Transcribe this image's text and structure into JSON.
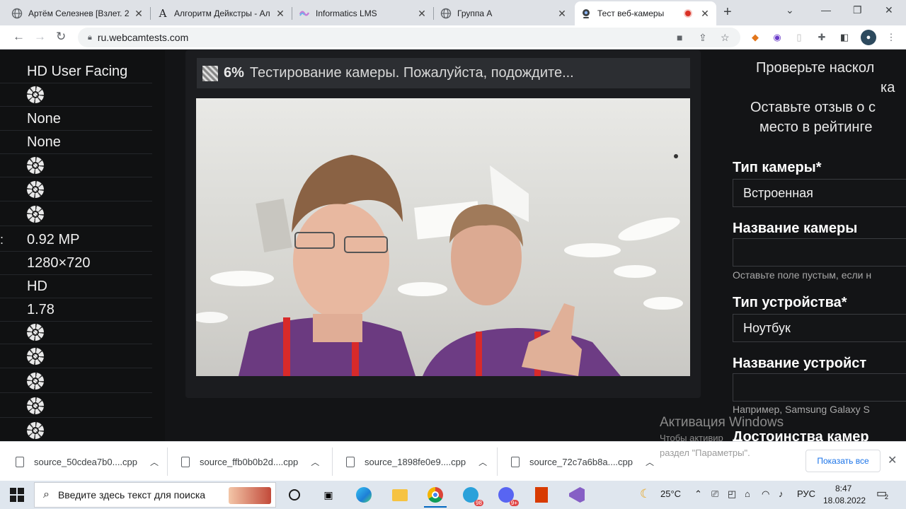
{
  "browser": {
    "tabs": [
      {
        "title": "Артём Селезнев [Взлет. 2",
        "icon": "globe-icon"
      },
      {
        "title": "Алгоритм Дейкстры - Ал",
        "icon": "wiki-a-icon"
      },
      {
        "title": "Informatics LMS",
        "icon": "lms-icon"
      },
      {
        "title": "Группа А",
        "icon": "globe-icon"
      },
      {
        "title": "Тест веб-камеры",
        "icon": "webcam-icon"
      }
    ],
    "active_tab": 4,
    "url": "ru.webcamtests.com"
  },
  "left_panel": {
    "rows": [
      {
        "key": "",
        "value": "HD User Facing",
        "icon": ""
      },
      {
        "key": "",
        "value": "",
        "icon": "loading-icon"
      },
      {
        "key": "",
        "value": "None",
        "icon": ""
      },
      {
        "key": "",
        "value": "None",
        "icon": ""
      },
      {
        "key": "",
        "value": "",
        "icon": "loading-icon"
      },
      {
        "key": "",
        "value": "",
        "icon": "loading-icon"
      },
      {
        "key": "",
        "value": "",
        "icon": "loading-icon"
      },
      {
        "key": ":",
        "value": "0.92 MP",
        "icon": ""
      },
      {
        "key": "",
        "value": "1280×720",
        "icon": ""
      },
      {
        "key": "",
        "value": "HD",
        "icon": ""
      },
      {
        "key": "",
        "value": "1.78",
        "icon": ""
      },
      {
        "key": "",
        "value": "",
        "icon": "loading-icon"
      },
      {
        "key": "",
        "value": "",
        "icon": "loading-icon"
      },
      {
        "key": "",
        "value": "",
        "icon": "loading-icon"
      },
      {
        "key": "",
        "value": "",
        "icon": "loading-icon"
      },
      {
        "key": "",
        "value": "",
        "icon": "loading-icon"
      }
    ]
  },
  "test": {
    "percent": "6%",
    "message": "Тестирование камеры. Пожалуйста, подождите..."
  },
  "form": {
    "intro_line1": "Проверьте наскол",
    "intro_line2": "ка",
    "intro_line3": "Оставьте отзыв о с",
    "intro_line4": "место в рейтинге",
    "camera_type_label": "Тип камеры*",
    "camera_type_value": "Встроенная",
    "camera_name_label": "Название камеры",
    "camera_name_hint": "Оставьте поле пустым, если н",
    "device_type_label": "Тип устройства*",
    "device_type_value": "Ноутбук",
    "device_name_label": "Название устройст",
    "device_name_hint": "Например, Samsung Galaxy S",
    "advantages_label": "Достоинства камер"
  },
  "watermark": {
    "title": "Активация Windows",
    "line1": "Чтобы активир",
    "line2": "раздел \"Параметры\"."
  },
  "downloads": {
    "items": [
      "source_50cdea7b0....cpp",
      "source_ffb0b0b2d....cpp",
      "source_1898fe0e9....cpp",
      "source_72c7a6b8a....cpp"
    ],
    "show_all": "Показать все"
  },
  "taskbar": {
    "search_placeholder": "Введите здесь текст для поиска",
    "temperature": "25°C",
    "language": "РУС",
    "time": "8:47",
    "date": "18.08.2022",
    "telegram_badge": "98",
    "discord_badge": "9+",
    "notification_count": "2"
  },
  "colors": {
    "page_bg": "#131416",
    "status_bg": "#2c2e32",
    "chrome_tabbar": "#dee1e6",
    "taskbar": "#dfe6ee",
    "show_all_text": "#1a73e8"
  }
}
